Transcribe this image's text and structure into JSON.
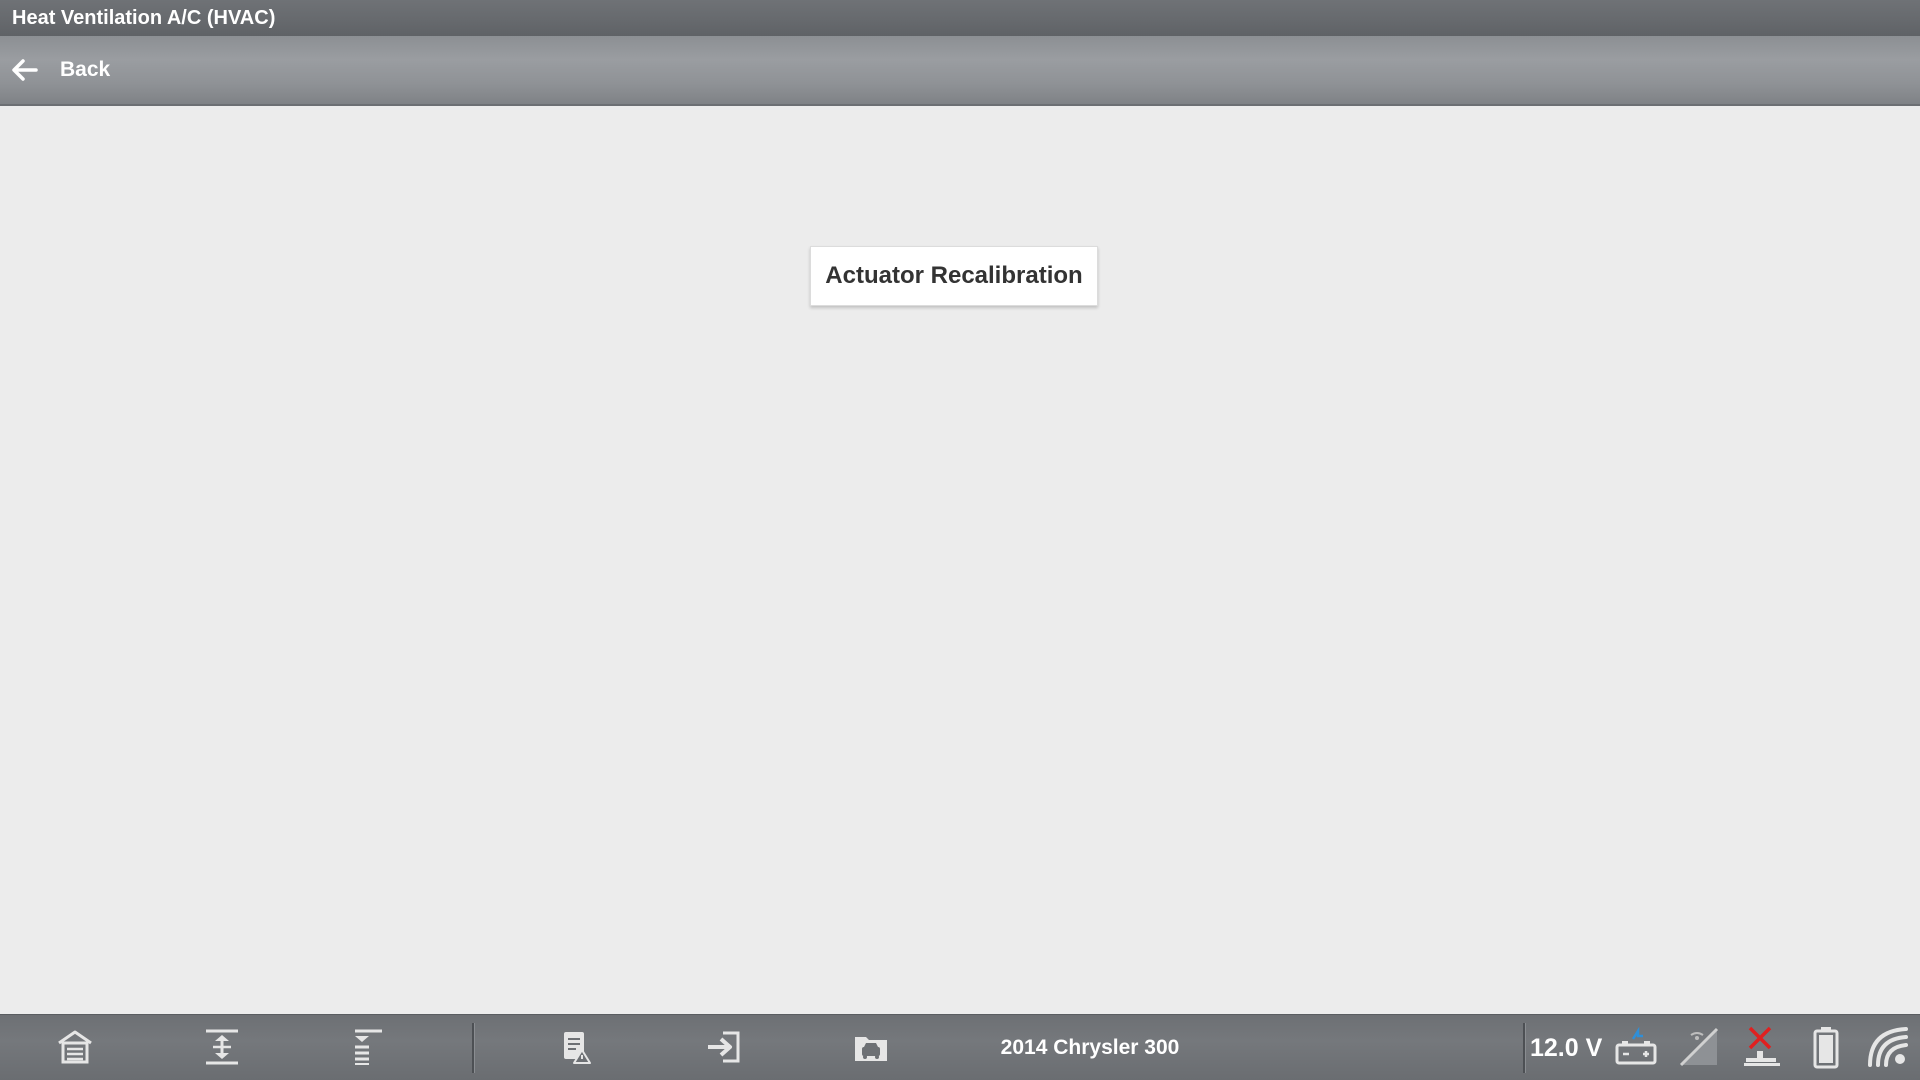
{
  "window": {
    "title": "Heat Ventilation A/C (HVAC)"
  },
  "toolbar": {
    "back_label": "Back",
    "back_icon": "arrow-left-icon"
  },
  "main": {
    "actions": [
      {
        "label": "Actuator Recalibration"
      }
    ]
  },
  "bottom_bar": {
    "icons_left": [
      "home-icon",
      "expand-icon",
      "collapse-icon",
      "report-icon",
      "exit-icon",
      "vehicle-folder-icon"
    ],
    "vehicle_label": "2014 Chrysler 300",
    "voltage": "12.0 V",
    "icons_right": [
      "battery-connection-icon",
      "no-signal-icon",
      "disconnected-vci-icon",
      "battery-level-icon",
      "wifi-icon"
    ]
  },
  "colors": {
    "content_bg": "#ececec",
    "header_gray": "#8c8f93",
    "alert_red": "#e02020",
    "accent_blue": "#2f8fd8"
  }
}
